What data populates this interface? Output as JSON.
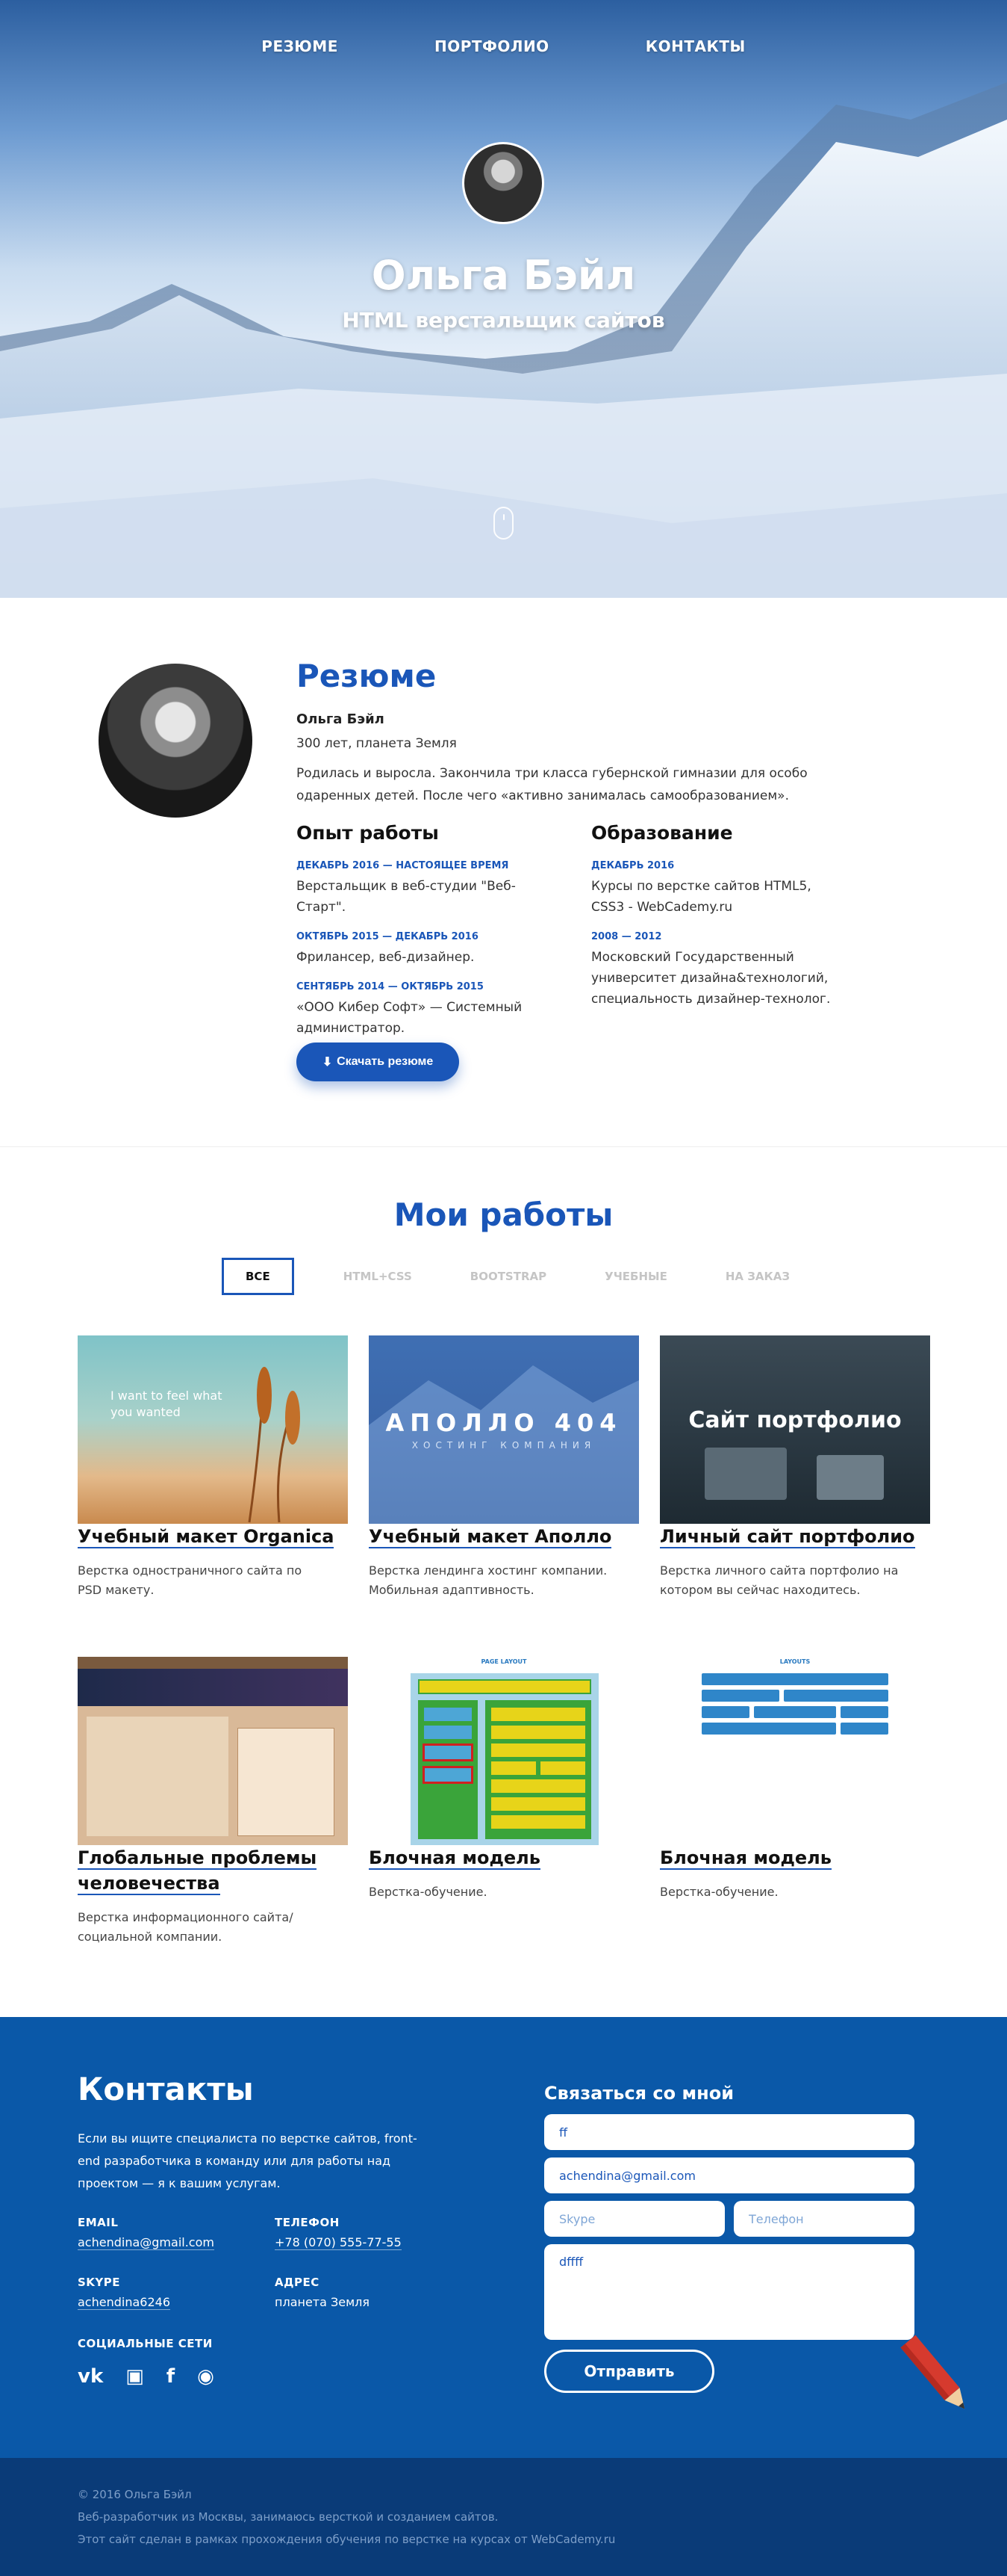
{
  "nav": {
    "items": [
      "РЕЗЮМЕ",
      "ПОРТФОЛИО",
      "КОНТАКТЫ"
    ]
  },
  "hero": {
    "name": "Ольга Бэйл",
    "role": "HTML верстальщик сайтов"
  },
  "resume": {
    "title": "Резюме",
    "name": "Ольга Бэйл",
    "age_location": "300 лет, планета Земля",
    "bio": "Родилась и выросла. Закончила три класса губернской гимназии для особо одаренных детей. После чего «активно занималась самообразованием».",
    "experience_title": "Опыт работы",
    "experience": [
      {
        "date": "ДЕКАБРЬ 2016 — НАСТОЯЩЕЕ ВРЕМЯ",
        "text": "Верстальщик в веб-студии \"Веб-Старт\"."
      },
      {
        "date": "ОКТЯБРЬ 2015 — ДЕКАБРЬ 2016",
        "text": "Фрилансер, веб-дизайнер."
      },
      {
        "date": "СЕНТЯБРЬ 2014 — ОКТЯБРЬ 2015",
        "text": "«ООО Кибер Софт» — Системный администратор."
      }
    ],
    "education_title": "Образование",
    "education": [
      {
        "date": "ДЕКАБРЬ 2016",
        "text": "Курсы по верстке сайтов HTML5, CSS3 - WebCademy.ru"
      },
      {
        "date": "2008 — 2012",
        "text": "Московский Государственный университет дизайна&технологий, специальность дизайнер-технолог."
      }
    ],
    "download_label": "Скачать резюме"
  },
  "portfolio": {
    "title": "Мои работы",
    "filters": [
      "ВСЕ",
      "HTML+CSS",
      "BOOTSTRAP",
      "УЧЕБНЫЕ",
      "НА ЗАКАЗ"
    ],
    "active_filter": "ВСЕ",
    "works": [
      {
        "title": "Учебный макет Organica",
        "desc": "Верстка одностраничного сайта по PSD макету.",
        "thumb_text": "I want to feel what you wanted"
      },
      {
        "title": "Учебный макет Аполло",
        "desc": "Верстка лендинга хостинг компании. Мобильная адаптивность.",
        "thumb_text": "АПОЛЛО 404",
        "thumb_sub": "ХОСТИНГ КОМПАНИЯ"
      },
      {
        "title": "Личный сайт портфолио",
        "desc": "Верстка личного сайта портфолио на котором вы сейчас находитесь.",
        "thumb_text": "Сайт портфолио"
      },
      {
        "title": "Глобальные проблемы человечества",
        "desc": "Верстка информационного сайта/социальной компании."
      },
      {
        "title": "Блочная модель",
        "desc": "Верстка-обучение.",
        "thumb_text": "PAGE LAYOUT"
      },
      {
        "title": "Блочная модель",
        "desc": "Верстка-обучение.",
        "thumb_text": "LAYOUTS"
      }
    ]
  },
  "contacts": {
    "title": "Контакты",
    "intro": "Если вы ищите специалиста по верстке сайтов, front-end разработчика в команду или для работы над проектом — я к вашим услугам.",
    "email_label": "EMAIL",
    "email": "achendina@gmail.com",
    "phone_label": "ТЕЛЕФОН",
    "phone": "+78 (070) 555-77-55",
    "skype_label": "SKYPE",
    "skype": "achendina6246",
    "address_label": "АДРЕС",
    "address": "планета Земля",
    "social_label": "СОЦИАЛЬНЫЕ СЕТИ",
    "form": {
      "title": "Связаться со мной",
      "name_value": "ff",
      "email_value": "achendina@gmail.com",
      "skype_placeholder": "Skype",
      "phone_placeholder": "Телефон",
      "message_value": "dffff",
      "send_label": "Отправить"
    }
  },
  "footer": {
    "copyright": "© 2016 Ольга Бэйл",
    "line1": "Веб-разработчик из Москвы, занимаюсь версткой и созданием сайтов.",
    "line2": "Этот сайт сделан в рамках прохождения обучения по верстке на курсах от WebCademy.ru"
  },
  "colors": {
    "accent": "#1a56b8",
    "contacts_bg": "#0a58a8",
    "footer_bg": "#0a3b78"
  }
}
